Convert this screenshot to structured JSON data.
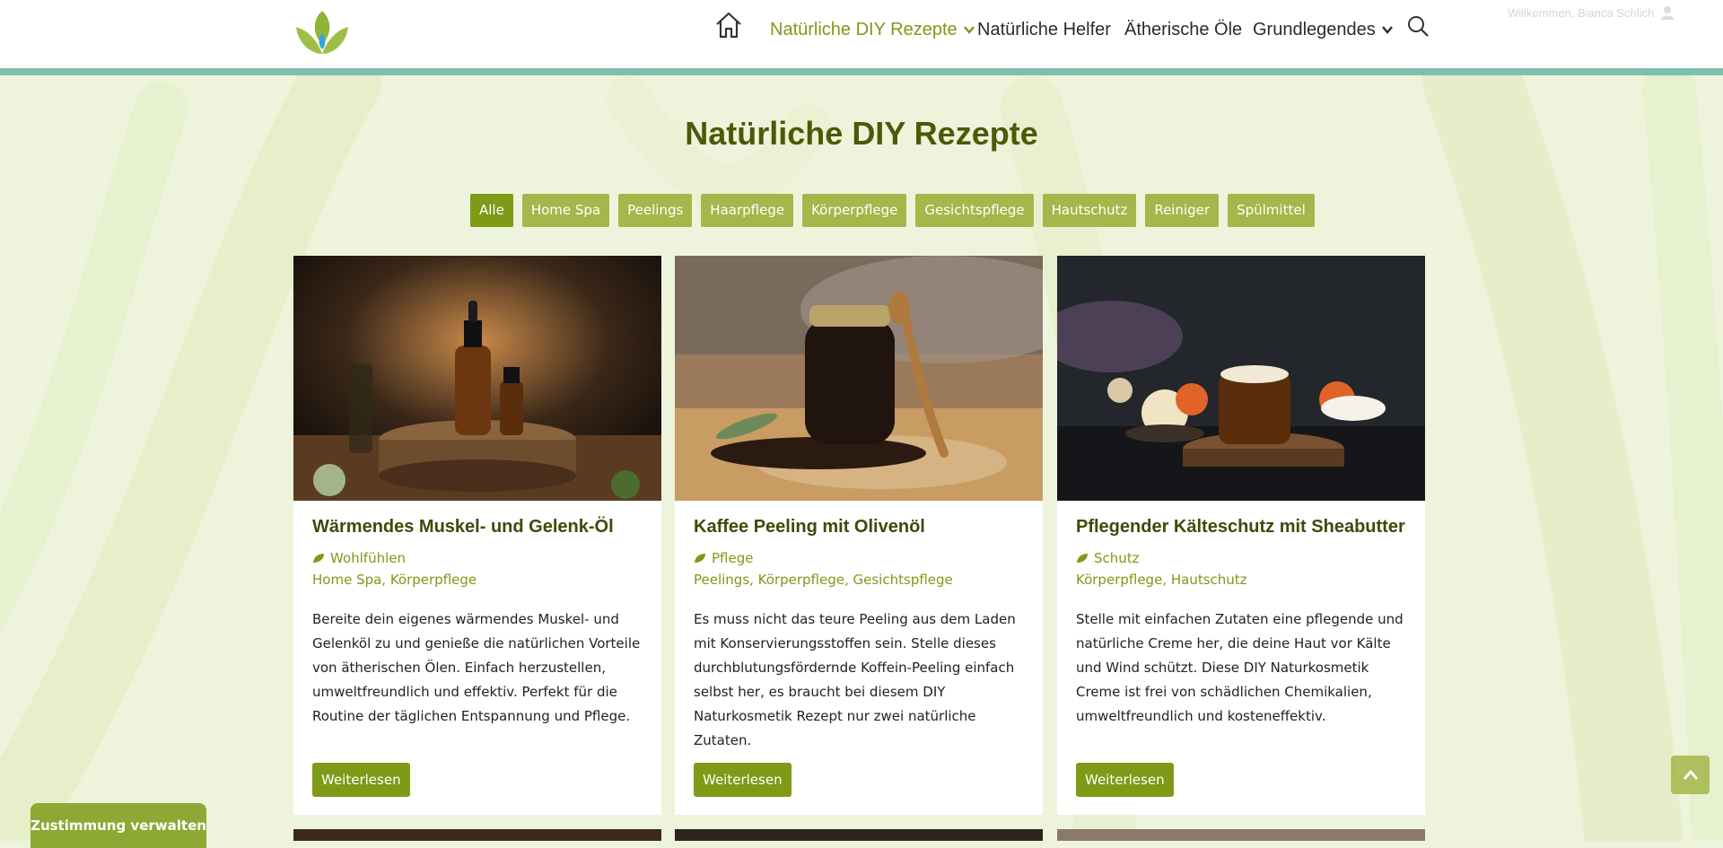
{
  "nav": {
    "items": [
      {
        "label": "Natürliche DIY Rezepte",
        "active": true,
        "dropdown": true
      },
      {
        "label": "Natürliche Helfer",
        "active": false,
        "dropdown": false
      },
      {
        "label": "Ätherische Öle",
        "active": false,
        "dropdown": false
      },
      {
        "label": "Grundlegendes",
        "active": false,
        "dropdown": true
      }
    ],
    "home_icon": "home-icon",
    "search_icon": "search-icon",
    "welcome": "Willkommen, Bianca Schlich"
  },
  "page": {
    "title": "Natürliche DIY Rezepte"
  },
  "filters": [
    "Alle",
    "Home Spa",
    "Peelings",
    "Haarpflege",
    "Körperpflege",
    "Gesichtspflege",
    "Hautschutz",
    "Reiniger",
    "Spülmittel"
  ],
  "filters_active": "Alle",
  "cards": [
    {
      "title": "Wärmendes Muskel- und Gelenk-Öl",
      "category": "Wohlfühlen",
      "tags": "Home Spa, Körperpflege",
      "text": "Bereite dein eigenes wärmendes Muskel- und Gelenköl zu und genieße die natürlichen Vorteile von ätherischen Ölen. Einfach herzustellen, umweltfreundlich und effektiv. Perfekt für die Routine der täglichen Entspannung und Pflege.",
      "button": "Weiterlesen"
    },
    {
      "title": "Kaffee Peeling mit Olivenöl",
      "category": "Pflege",
      "tags": "Peelings, Körperpflege, Gesichtspflege",
      "text": "Es muss nicht das teure Peeling aus dem Laden mit Konservierungsstoffen sein. Stelle dieses durchblutungsfördernde Koffein-Peeling einfach selbst her, es braucht bei diesem DIY Naturkosmetik Rezept nur zwei natürliche Zutaten.",
      "button": "Weiterlesen"
    },
    {
      "title": "Pflegender Kälteschutz mit Sheabutter",
      "category": "Schutz",
      "tags": "Körperpflege, Hautschutz",
      "text": "Stelle mit einfachen Zutaten eine pflegende und natürliche Creme her, die deine Haut vor Kälte und Wind schützt. Diese DIY Naturkosmetik Creme ist frei von schädlichen Chemikalien, umweltfreundlich und kosteneffektiv.",
      "button": "Weiterlesen"
    }
  ],
  "consent": {
    "label": "Zustimmung verwalten"
  },
  "icons": {
    "category": "leaf-icon",
    "to_top": "chevron-up-icon",
    "user": "user-icon"
  },
  "colors": {
    "accent": "#7e9a17",
    "filter": "#a4b74a",
    "title": "#4a5a06",
    "teal_bar": "#7fbfb2",
    "background": "#eef4db"
  }
}
